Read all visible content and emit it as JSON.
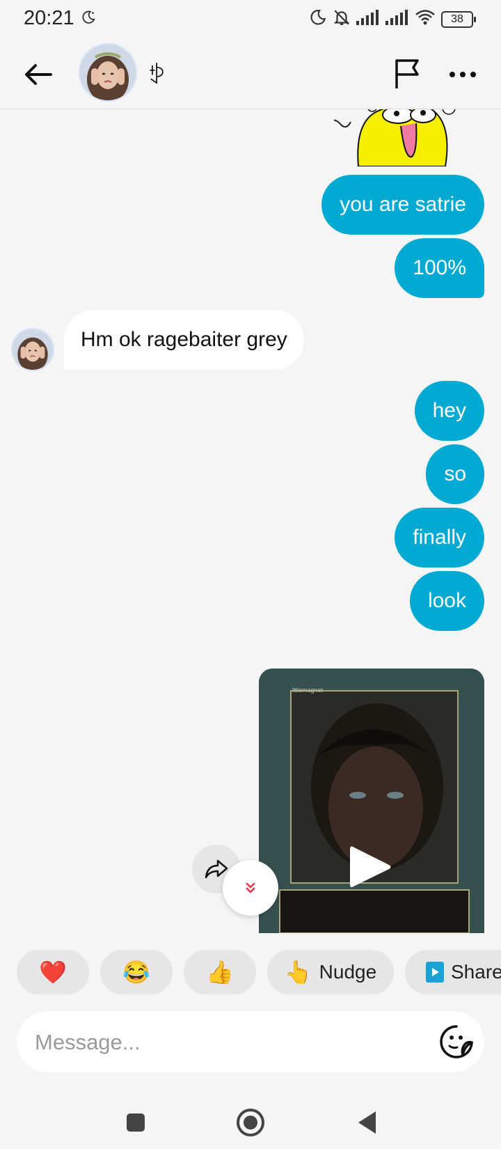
{
  "status_bar": {
    "time": "20:21",
    "battery": "38",
    "icons": [
      "moon-icon",
      "bell-off-icon",
      "signal-icon",
      "signal-icon",
      "wifi-icon",
      "battery-icon"
    ]
  },
  "header": {
    "contact_name": "ꉣ",
    "back_icon": "arrow-left-icon",
    "report_icon": "flag-icon",
    "more_icon": "more-dots-icon"
  },
  "messages": [
    {
      "type": "sticker",
      "direction": "outgoing"
    },
    {
      "type": "text",
      "direction": "outgoing",
      "text": "you are satrie"
    },
    {
      "type": "text",
      "direction": "outgoing",
      "text": "100%"
    },
    {
      "type": "text",
      "direction": "incoming",
      "text": "Hm ok ragebaiter grey"
    },
    {
      "type": "text",
      "direction": "outgoing",
      "text": "hey"
    },
    {
      "type": "text",
      "direction": "outgoing",
      "text": "so"
    },
    {
      "type": "text",
      "direction": "outgoing",
      "text": "finally"
    },
    {
      "type": "text",
      "direction": "outgoing",
      "text": "look"
    },
    {
      "type": "video",
      "direction": "outgoing",
      "watermark": "lttlemagnet"
    }
  ],
  "quick_replies": [
    {
      "emoji": "❤️",
      "label": ""
    },
    {
      "emoji": "😂",
      "label": ""
    },
    {
      "emoji": "👍",
      "label": ""
    },
    {
      "emoji": "👆",
      "label": "Nudge"
    },
    {
      "emoji": "▶",
      "label": "Share"
    }
  ],
  "composer": {
    "placeholder": "Message...",
    "sticker_icon": "sticker-face-icon"
  },
  "colors": {
    "outgoing_bubble": "#00aad2",
    "incoming_bubble": "#ffffff",
    "background": "#f5f5f5",
    "accent_red": "#e8334d"
  },
  "nav": [
    "square-icon",
    "home-circle-icon",
    "back-triangle-icon"
  ]
}
